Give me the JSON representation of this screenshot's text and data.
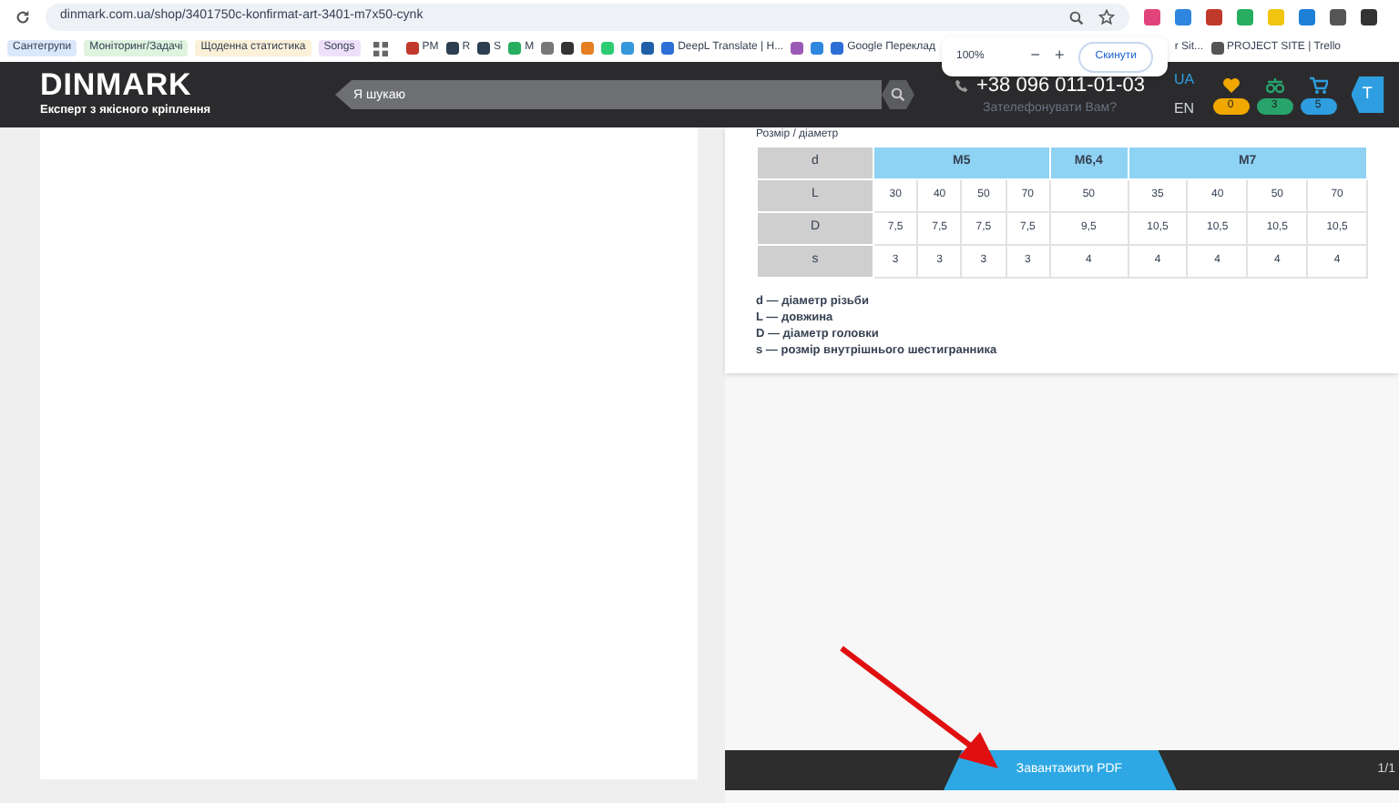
{
  "browser": {
    "url": "dinmark.com.ua/shop/3401750c-konfirmat-art-3401-m7x50-cynk",
    "bookmarks": [
      {
        "label": "Сантегрупи",
        "color": "#dbe8fb"
      },
      {
        "label": "Моніторинг/Задачі",
        "color": "#dff3df"
      },
      {
        "label": "Щоденна статистика",
        "color": "#fbf0d8"
      },
      {
        "label": "Songs",
        "color": "#efe0fa"
      }
    ],
    "shortcuts": [
      "PM",
      "R",
      "S",
      "M",
      "DeepL Translate | H...",
      "Google Переклад"
    ],
    "shortcuts_right": [
      "r Sit...",
      "PROJECT SITE | Trello"
    ],
    "zoom_popup": {
      "level": "100%",
      "minus": "−",
      "plus": "+",
      "reset": "Скинути"
    }
  },
  "header": {
    "logo": "DINMARK",
    "tagline": "Експерт з якісного кріплення",
    "search": {
      "placeholder": "Я шукаю"
    },
    "phone": "+38 096 011-01-03",
    "callback": "Зателефонувати Вам?",
    "languages": [
      {
        "label": "UA",
        "selected": true
      },
      {
        "label": "EN",
        "selected": false
      }
    ],
    "counters": [
      {
        "count": "0",
        "color": "#f0a800"
      },
      {
        "count": "3",
        "color": "#27a36b"
      },
      {
        "count": "5",
        "color": "#2e9ee0"
      }
    ],
    "avatar": "T"
  },
  "spec": {
    "heading": "Розмір / діаметр",
    "groups": [
      "M5",
      "M6,4",
      "M7"
    ],
    "rows": [
      {
        "label": "d"
      },
      {
        "label": "L",
        "cells": [
          "30",
          "40",
          "50",
          "70",
          "50",
          "35",
          "40",
          "50",
          "70"
        ]
      },
      {
        "label": "D",
        "cells": [
          "7,5",
          "7,5",
          "7,5",
          "7,5",
          "9,5",
          "10,5",
          "10,5",
          "10,5",
          "10,5"
        ]
      },
      {
        "label": "s",
        "cells": [
          "3",
          "3",
          "3",
          "3",
          "4",
          "4",
          "4",
          "4",
          "4"
        ]
      }
    ],
    "legend": [
      "d — діаметр різьби",
      "L — довжина",
      "D — діаметр головки",
      "s — розмір внутрішнього шестигранника"
    ]
  },
  "pdf_bar": {
    "button": "Завантажити PDF",
    "pages": "1/1"
  }
}
